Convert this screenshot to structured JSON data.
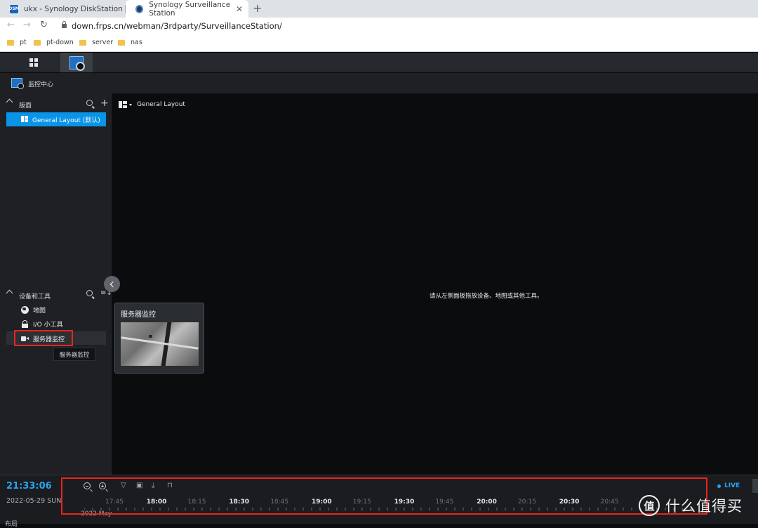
{
  "browser": {
    "tabs": [
      {
        "label": "ukx - Synology DiskStation",
        "favicon": "DSM",
        "active": false
      },
      {
        "label": "Synology Surveillance Station",
        "active": true
      }
    ],
    "new_tab": "+",
    "url": "down.frps.cn/webman/3rdparty/SurveillanceStation/",
    "bookmarks": [
      "pt",
      "pt-down",
      "server",
      "nas"
    ]
  },
  "app": {
    "title": "监控中心",
    "accent": "#0a94e8"
  },
  "sidebar": {
    "layouts_section": "版面",
    "layout_item": "General Layout (默认)",
    "devices_section": "设备和工具",
    "items": [
      {
        "label": "地图",
        "icon": "globe-icon"
      },
      {
        "label": "I/O 小工具",
        "icon": "io-module-icon"
      },
      {
        "label": "服务器监控",
        "icon": "camera-icon"
      }
    ],
    "tooltip": "服务器监控"
  },
  "main": {
    "layout_selector": "General Layout",
    "hint": "请从左侧面板拖放设备、地图或其他工具。",
    "drag_card_title": "服务器监控"
  },
  "timeline": {
    "clock": "21:33:06",
    "date": "2022-05-29 SUN",
    "ticks": [
      "17:45",
      "18:00",
      "18:15",
      "18:30",
      "18:45",
      "19:00",
      "19:15",
      "19:30",
      "19:45",
      "20:00",
      "20:15",
      "20:30",
      "20:45"
    ],
    "major_ticks": [
      "18:00",
      "18:30",
      "19:00",
      "19:30",
      "20:00",
      "20:30"
    ],
    "month": "2022 May",
    "live": "LIVE",
    "bottom_label": "布局"
  },
  "watermark": {
    "logo": "值",
    "text": "什么值得买"
  }
}
